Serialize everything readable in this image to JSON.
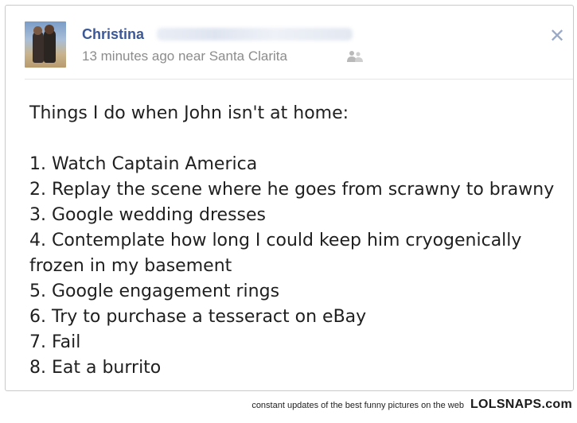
{
  "post": {
    "author": "Christina",
    "meta": "13 minutes ago near Santa Clarita",
    "privacy_icon": "people-icon",
    "close_icon": "close-icon",
    "lines": [
      "Things I do when John isn't at home:",
      "1. Watch Captain America",
      "2. Replay the scene where he goes from scrawny to brawny",
      "3. Google wedding dresses",
      "4. Contemplate how long I could keep him cryogenically",
      "frozen in my basement",
      "5. Google engagement rings",
      "6. Try to purchase a tesseract on eBay",
      "7. Fail",
      "8. Eat a burrito"
    ],
    "close_symbol": "✕"
  },
  "footer": {
    "tagline": "constant updates of the best funny pictures on the web",
    "brand": "LOLSNAPS.com"
  },
  "colors": {
    "author_name": "#3b5998",
    "meta_text": "#8c8c8c",
    "body_text": "#1f1f1f"
  }
}
